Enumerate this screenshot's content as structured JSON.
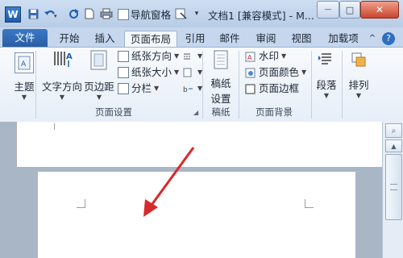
{
  "titlebar": {
    "app_icon": "W",
    "qa_items": [
      "save-icon",
      "undo-icon",
      "redo-icon",
      "new-doc-icon",
      "print-icon"
    ],
    "nav_pane_label": "导航窗格",
    "title": "文档1 [兼容模式] - M...",
    "minimize": "—",
    "maximize": "□",
    "close": "✕"
  },
  "tabs": [
    "文件",
    "开始",
    "插入",
    "页面布局",
    "引用",
    "邮件",
    "审阅",
    "视图",
    "加载项"
  ],
  "ribbon": {
    "theme": {
      "label": "主题"
    },
    "page_setup": {
      "text_direction": "文字方向",
      "margins": "页边距",
      "orientation": "纸张方向",
      "size": "纸张大小",
      "columns": "分栏",
      "group_label": "页面设置"
    },
    "draft": {
      "label1": "稿纸",
      "label2": "设置",
      "group_label": "稿纸"
    },
    "page_background": {
      "watermark": "水印",
      "page_color": "页面颜色",
      "page_border": "页面边框",
      "group_label": "页面背景"
    },
    "paragraph": {
      "label": "段落"
    },
    "arrange": {
      "label": "排列"
    }
  },
  "colors": {
    "file_tab": "#2a5ea5",
    "arrow": "#d9282a"
  }
}
